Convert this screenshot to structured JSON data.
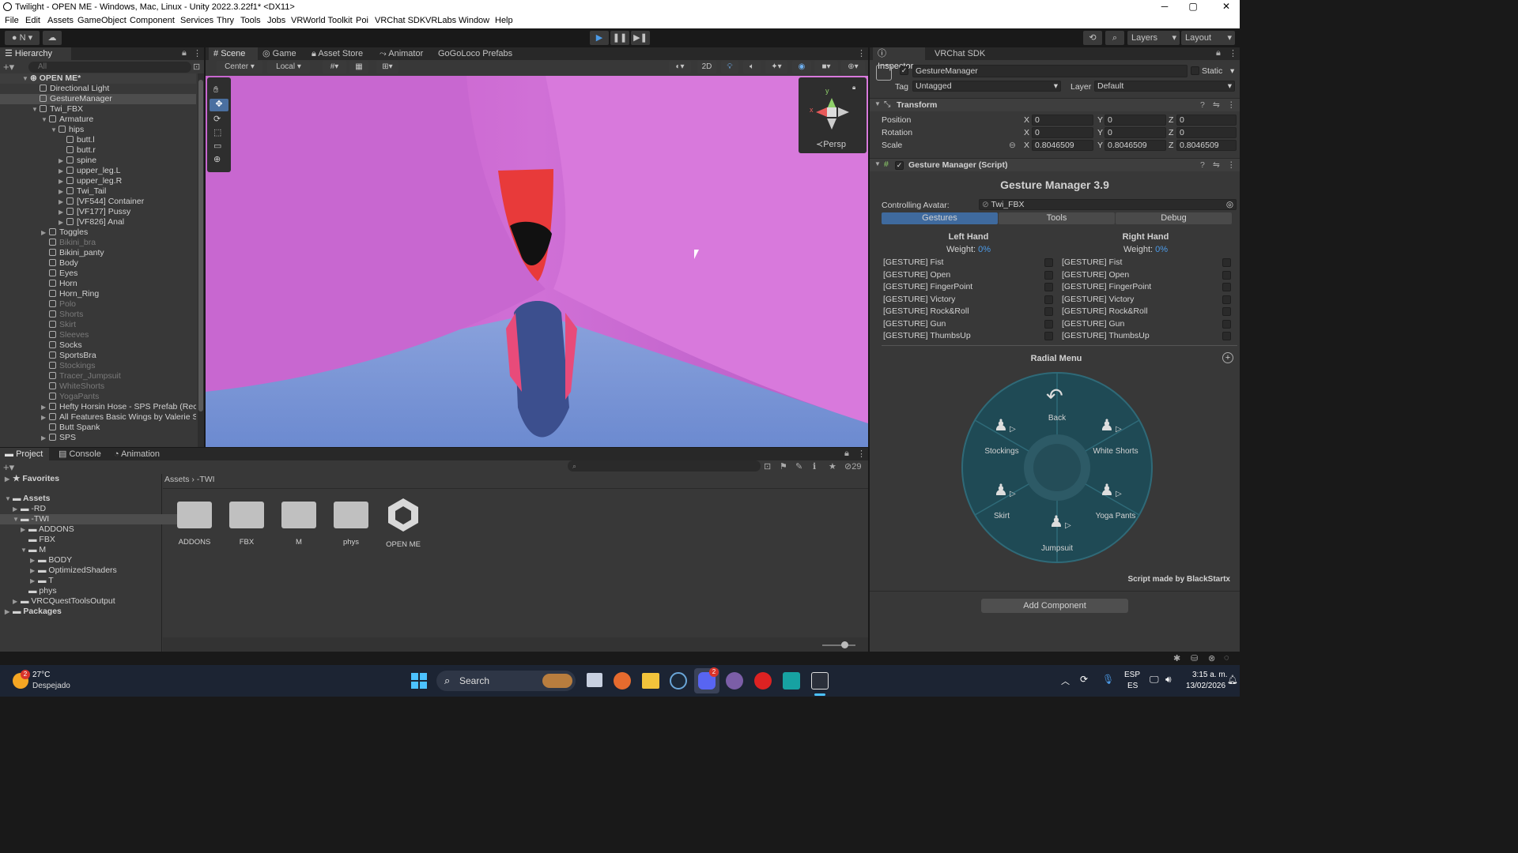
{
  "window": {
    "title": "Twilight - OPEN ME - Windows, Mac, Linux - Unity 2022.3.22f1* <DX11>",
    "minimize": "─",
    "maximize": "▢",
    "close": "✕"
  },
  "menu": [
    "File",
    "Edit",
    "Assets",
    "GameObject",
    "Component",
    "Services",
    "Thry",
    "Tools",
    "Jobs",
    "VRWorld Toolkit",
    "Poi",
    "VRChat SDK",
    "VRLabs",
    "Window",
    "Help"
  ],
  "toolbar": {
    "account": "N",
    "layers": "Layers",
    "layout": "Layout"
  },
  "hierarchy": {
    "tab": "Hierarchy",
    "search_placeholder": "All",
    "scene": "OPEN ME*",
    "rows": [
      {
        "label": "Directional Light"
      },
      {
        "label": "GestureManager"
      },
      {
        "label": "Twi_FBX"
      },
      {
        "label": "Armature"
      },
      {
        "label": "hips"
      },
      {
        "label": "butt.l"
      },
      {
        "label": "butt.r"
      },
      {
        "label": "spine"
      },
      {
        "label": "upper_leg.L"
      },
      {
        "label": "upper_leg.R"
      },
      {
        "label": "Twi_Tail"
      },
      {
        "label": "[VF544] Container"
      },
      {
        "label": "[VF177] Pussy"
      },
      {
        "label": "[VF826] Anal"
      },
      {
        "label": "Toggles"
      },
      {
        "label": "Bikini_bra"
      },
      {
        "label": "Bikini_panty"
      },
      {
        "label": "Body"
      },
      {
        "label": "Eyes"
      },
      {
        "label": "Horn"
      },
      {
        "label": "Horn_Ring"
      },
      {
        "label": "Polo"
      },
      {
        "label": "Shorts"
      },
      {
        "label": "Skirt"
      },
      {
        "label": "Sleeves"
      },
      {
        "label": "Socks"
      },
      {
        "label": "SportsBra"
      },
      {
        "label": "Stockings"
      },
      {
        "label": "Tracer_Jumpsuit"
      },
      {
        "label": "WhiteShorts"
      },
      {
        "label": "YogaPants"
      },
      {
        "label": "Hefty Horsin Hose - SPS Prefab (Recc"
      },
      {
        "label": "All Features Basic Wings by Valerie Sr"
      },
      {
        "label": "Butt Spank"
      },
      {
        "label": "SPS"
      }
    ]
  },
  "scene_tabs": [
    "Scene",
    "Game",
    "Asset Store",
    "Animator",
    "GoGoLoco Prefabs"
  ],
  "scene_toolbar": {
    "pivot": "Center",
    "space": "Local",
    "mode2d": "2D"
  },
  "gizmo": {
    "persp": "Persp",
    "x": "x",
    "y": "y"
  },
  "project": {
    "tabs": [
      "Project",
      "Console",
      "Animation"
    ],
    "favorites": "Favorites",
    "assets": "Assets",
    "tree": [
      "-RD",
      "-TWI",
      "ADDONS",
      "FBX",
      "M",
      "BODY",
      "OptimizedShaders",
      "T",
      "phys",
      "VRCQuestToolsOutput"
    ],
    "packages": "Packages",
    "breadcrumb": [
      "Assets",
      "-TWI"
    ],
    "hidden_count": "29",
    "files": [
      "ADDONS",
      "FBX",
      "M",
      "phys",
      "OPEN ME"
    ]
  },
  "inspector": {
    "tabs": [
      "Inspector",
      "VRChat SDK"
    ],
    "object_name": "GestureManager",
    "static": "Static",
    "tag_label": "Tag",
    "tag": "Untagged",
    "layer_label": "Layer",
    "layer": "Default",
    "transform": {
      "title": "Transform",
      "position": {
        "label": "Position",
        "x": "0",
        "y": "0",
        "z": "0"
      },
      "rotation": {
        "label": "Rotation",
        "x": "0",
        "y": "0",
        "z": "0"
      },
      "scale": {
        "label": "Scale",
        "x": "0.8046509",
        "y": "0.8046509",
        "z": "0.8046509"
      },
      "axes": {
        "x": "X",
        "y": "Y",
        "z": "Z"
      }
    },
    "script": {
      "title": "Gesture Manager (Script)",
      "heading": "Gesture Manager 3.9",
      "controlling_label": "Controlling Avatar:",
      "controlling_value": "Twi_FBX",
      "tabs": [
        "Gestures",
        "Tools",
        "Debug"
      ],
      "left_hand": "Left Hand",
      "right_hand": "Right Hand",
      "weight_label": "Weight:",
      "weight_value": "0%",
      "gestures": [
        "[GESTURE] Fist",
        "[GESTURE] Open",
        "[GESTURE] FingerPoint",
        "[GESTURE] Victory",
        "[GESTURE] Rock&Roll",
        "[GESTURE] Gun",
        "[GESTURE] ThumbsUp"
      ],
      "radial_title": "Radial Menu",
      "radial_items": [
        "Back",
        "White Shorts",
        "Yoga Pants",
        "Jumpsuit",
        "Skirt",
        "Stockings"
      ],
      "credit": "Script made by BlackStartx"
    },
    "add_component": "Add Component"
  },
  "taskbar": {
    "temp": "27°C",
    "weather": "Despejado",
    "weather_badge": "2",
    "search": "Search",
    "lang1": "ESP",
    "lang2": "ES",
    "time": "3:15 a. m.",
    "date": "13/02/2026",
    "discord_badge": "2"
  }
}
